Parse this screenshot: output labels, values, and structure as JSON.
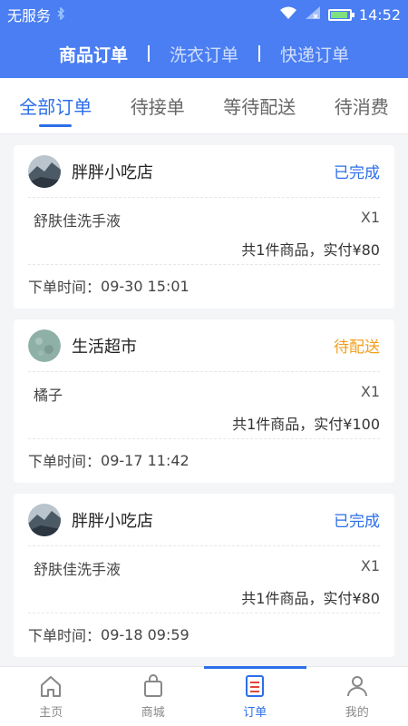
{
  "status_bar": {
    "carrier": "无服务",
    "time": "14:52"
  },
  "top_tabs": [
    {
      "label": "商品订单",
      "active": true
    },
    {
      "label": "洗衣订单",
      "active": false
    },
    {
      "label": "快递订单",
      "active": false
    }
  ],
  "sub_tabs": [
    {
      "label": "全部订单",
      "active": true
    },
    {
      "label": "待接单",
      "active": false
    },
    {
      "label": "等待配送",
      "active": false
    },
    {
      "label": "待消费",
      "active": false
    }
  ],
  "orders": [
    {
      "shop": "胖胖小吃店",
      "status": "已完成",
      "status_type": "done",
      "item": "舒肤佳洗手液",
      "qty": "X1",
      "summary": "共1件商品，实付¥80",
      "time_label": "下单时间：",
      "time": "09-30 15:01",
      "avatar": "landscape"
    },
    {
      "shop": "生活超市",
      "status": "待配送",
      "status_type": "pending",
      "item": "橘子",
      "qty": "X1",
      "summary": "共1件商品，实付¥100",
      "time_label": "下单时间：",
      "time": "09-17 11:42",
      "avatar": "texture"
    },
    {
      "shop": "胖胖小吃店",
      "status": "已完成",
      "status_type": "done",
      "item": "舒肤佳洗手液",
      "qty": "X1",
      "summary": "共1件商品，实付¥80",
      "time_label": "下单时间：",
      "time": "09-18 09:59",
      "avatar": "landscape"
    }
  ],
  "bottom_nav": [
    {
      "label": "主页",
      "icon": "home-icon",
      "active": false
    },
    {
      "label": "商城",
      "icon": "shopping-bag-icon",
      "active": false
    },
    {
      "label": "订单",
      "icon": "order-list-icon",
      "active": true
    },
    {
      "label": "我的",
      "icon": "user-icon",
      "active": false
    }
  ],
  "colors": {
    "primary": "#4a7ef2",
    "accent": "#2c6ee8",
    "pending": "#f0a020"
  }
}
